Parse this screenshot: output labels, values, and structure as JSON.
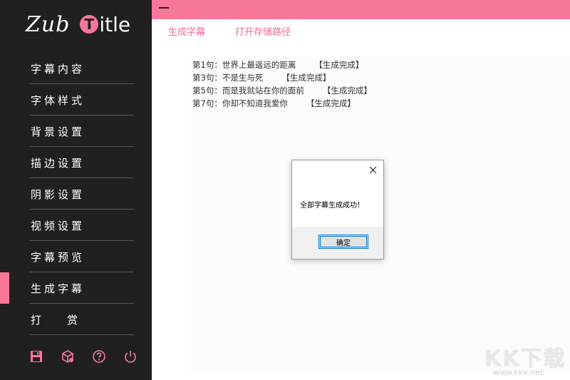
{
  "app": {
    "logo_script": "Zub",
    "logo_t": "T",
    "logo_rest": "itle"
  },
  "sidebar": {
    "items": [
      {
        "label": "字幕内容"
      },
      {
        "label": "字体样式"
      },
      {
        "label": "背景设置"
      },
      {
        "label": "描边设置"
      },
      {
        "label": "阴影设置"
      },
      {
        "label": "视频设置"
      },
      {
        "label": "字幕预览"
      },
      {
        "label": "生成字幕",
        "active": true
      },
      {
        "label": "打赏"
      }
    ],
    "bottom_icons": [
      "save-icon",
      "package-icon",
      "help-icon",
      "power-icon"
    ]
  },
  "toolbar": {
    "generate_label": "生成字幕",
    "open_path_label": "打开存储路径"
  },
  "log": {
    "lines": [
      {
        "text": "第1句：世界上最遥远的距离",
        "status": "【生成完成】"
      },
      {
        "text": "第3句：不是生与死",
        "status": "【生成完成】"
      },
      {
        "text": "第5句：而是我就站在你的面前",
        "status": "【生成完成】"
      },
      {
        "text": "第7句：你却不知道我爱你",
        "status": "【生成完成】"
      }
    ]
  },
  "dialog": {
    "message": "全部字幕生成成功！",
    "ok_label": "确定"
  },
  "watermark": {
    "big": "KK下载",
    "small": "www.kkx.net"
  },
  "colors": {
    "accent": "#f7779a",
    "sidebar_bg": "#202020",
    "link": "#f06b90"
  }
}
